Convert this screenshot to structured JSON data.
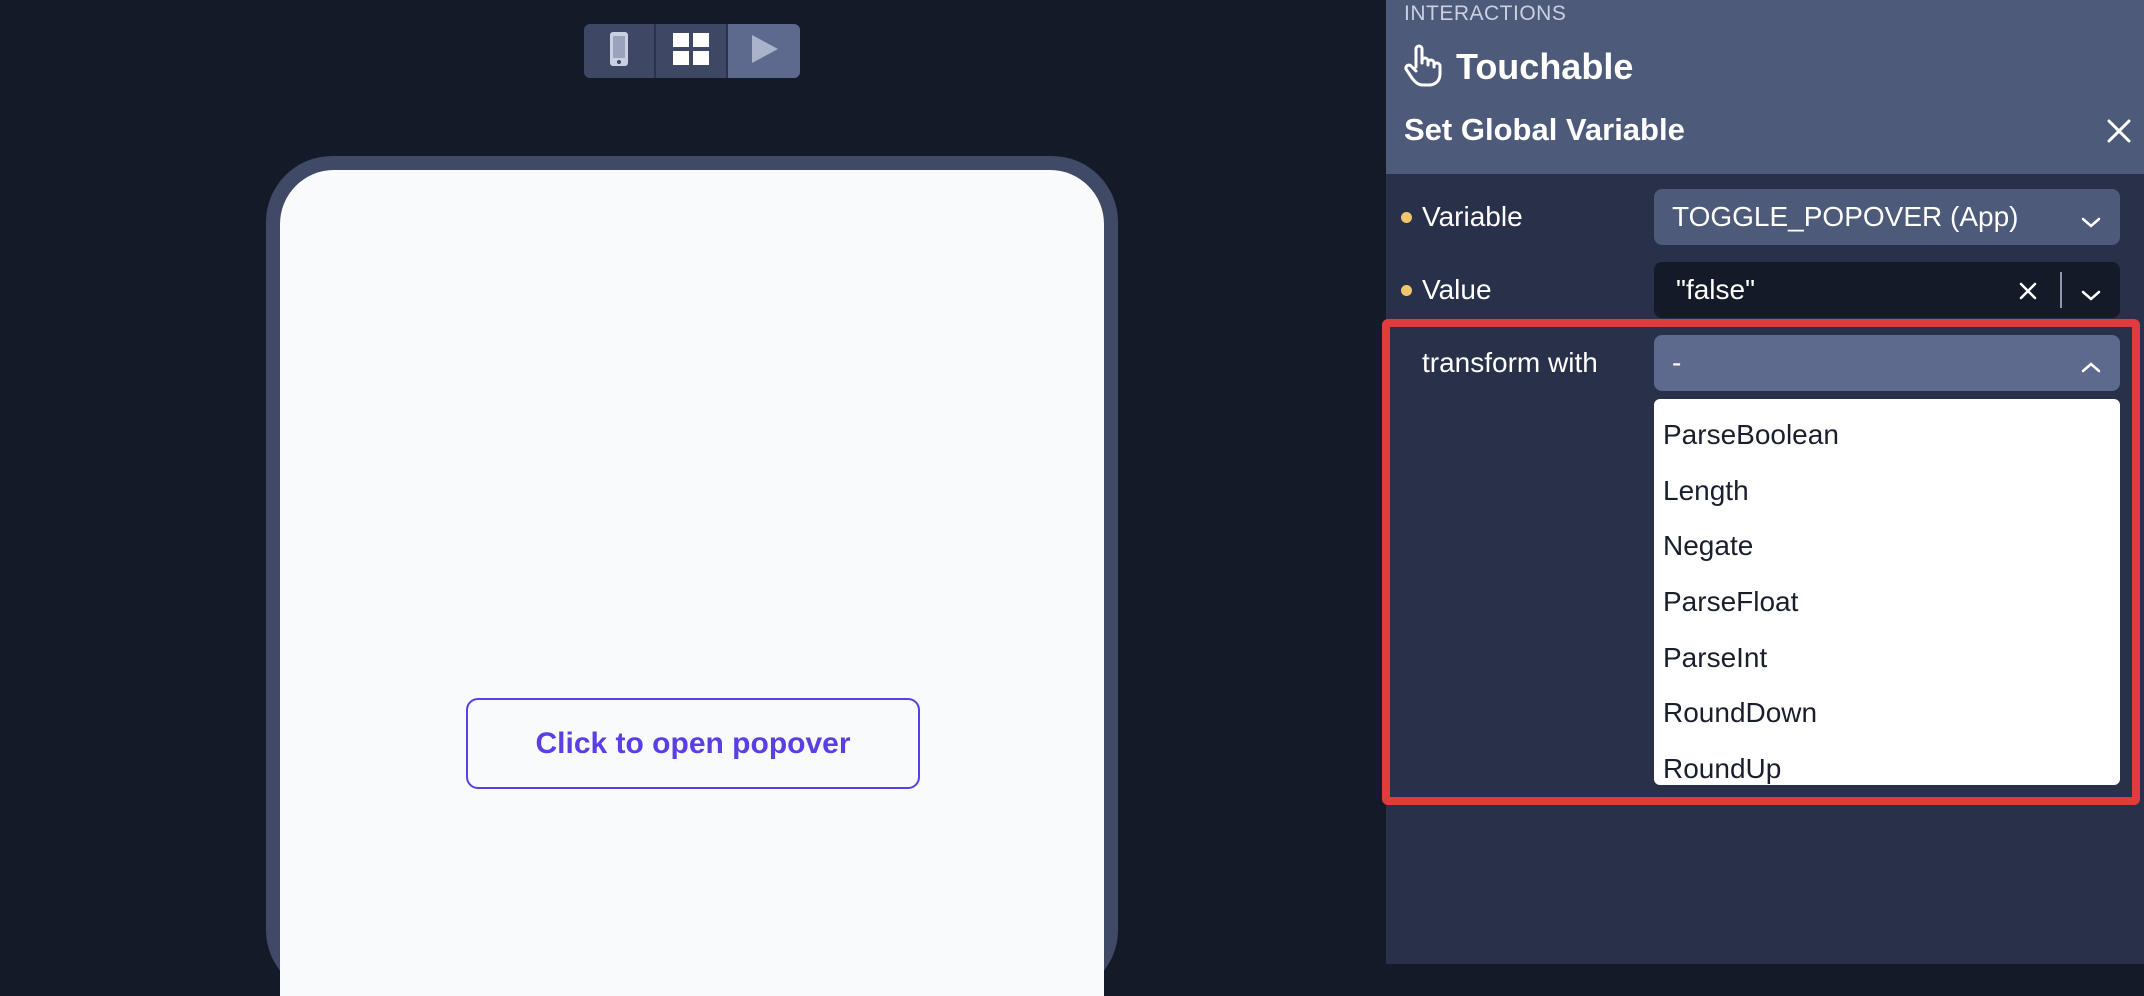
{
  "toolbar": {
    "buttons": [
      {
        "name": "device-preview",
        "icon": "phone-icon"
      },
      {
        "name": "grid-view",
        "icon": "grid-icon"
      },
      {
        "name": "play-preview",
        "icon": "play-icon"
      }
    ]
  },
  "preview": {
    "button_label": "Click to open popover"
  },
  "panel": {
    "section_label": "INTERACTIONS",
    "component_title": "Touchable",
    "component_icon": "hand-pointer-icon",
    "action_title": "Set Global Variable",
    "fields": {
      "variable": {
        "label": "Variable",
        "value": "TOGGLE_POPOVER (App)"
      },
      "value": {
        "label": "Value",
        "value": "\"false\""
      },
      "transform": {
        "label": "transform with",
        "value": "-"
      }
    },
    "transform_options": [
      "ParseBoolean",
      "Length",
      "Negate",
      "ParseFloat",
      "ParseInt",
      "RoundDown",
      "RoundUp"
    ]
  },
  "colors": {
    "accent": "#5a3ee6",
    "highlight": "#e23b3f",
    "required_dot": "#f2c46d",
    "panel_bg": "#283149",
    "canvas_bg": "#151a28"
  }
}
